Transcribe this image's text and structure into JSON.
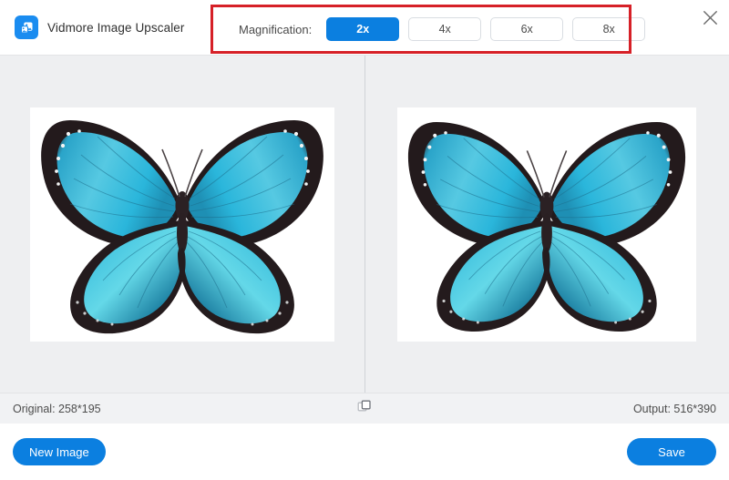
{
  "app": {
    "title": "Vidmore Image Upscaler",
    "logo_icon": "image-photo-icon",
    "accent_color": "#0b7fe0",
    "highlight_color": "#d62027",
    "background_color": "#eeeff1"
  },
  "header": {
    "magnification_label": "Magnification:",
    "magnification_options": [
      {
        "label": "2x",
        "selected": true
      },
      {
        "label": "4x",
        "selected": false
      },
      {
        "label": "6x",
        "selected": false
      },
      {
        "label": "8x",
        "selected": false
      }
    ],
    "close_icon": "close-icon"
  },
  "preview": {
    "original_image_alt": "blue morpho butterfly",
    "output_image_alt": "blue morpho butterfly upscaled"
  },
  "statusbar": {
    "original": "Original: 258*195",
    "output": "Output: 516*390",
    "compare_icon": "compare-squares-icon"
  },
  "footer": {
    "new_image_label": "New Image",
    "save_label": "Save"
  }
}
